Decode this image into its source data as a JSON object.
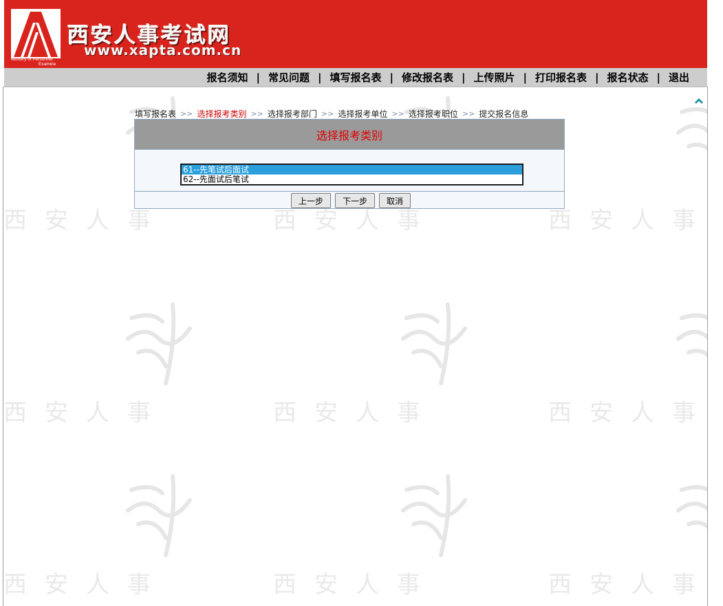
{
  "header": {
    "site_title": "西安人事考试网",
    "site_url": "www.xapta.com.cn",
    "logo_caption_line1": "Ministry of Personnel",
    "logo_caption_line2": "Examine"
  },
  "nav": {
    "items": [
      "报名须知",
      "常见问题",
      "填写报名表",
      "修改报名表",
      "上传照片",
      "打印报名表",
      "报名状态",
      "退出"
    ],
    "separator": "|"
  },
  "steps": {
    "items": [
      "填写报名表",
      "选择报考类别",
      "选择报考部门",
      "选择报考单位",
      "选择报考职位",
      "提交报名信息"
    ],
    "active_index": 1,
    "separator": ">>"
  },
  "panel": {
    "title": "选择报考类别",
    "options": [
      "61--先笔试后面试",
      "62--先面试后笔试"
    ],
    "selected_index": 0
  },
  "buttons": {
    "prev": "上一步",
    "next": "下一步",
    "cancel": "取消"
  },
  "watermark": {
    "text": "西安人事"
  },
  "colors": {
    "banner": "#d9241d",
    "navbar": "#cdcdcd",
    "panel_header": "#9a9a9a",
    "title_red": "#e10000",
    "selected_option": "#2a9fdc"
  }
}
